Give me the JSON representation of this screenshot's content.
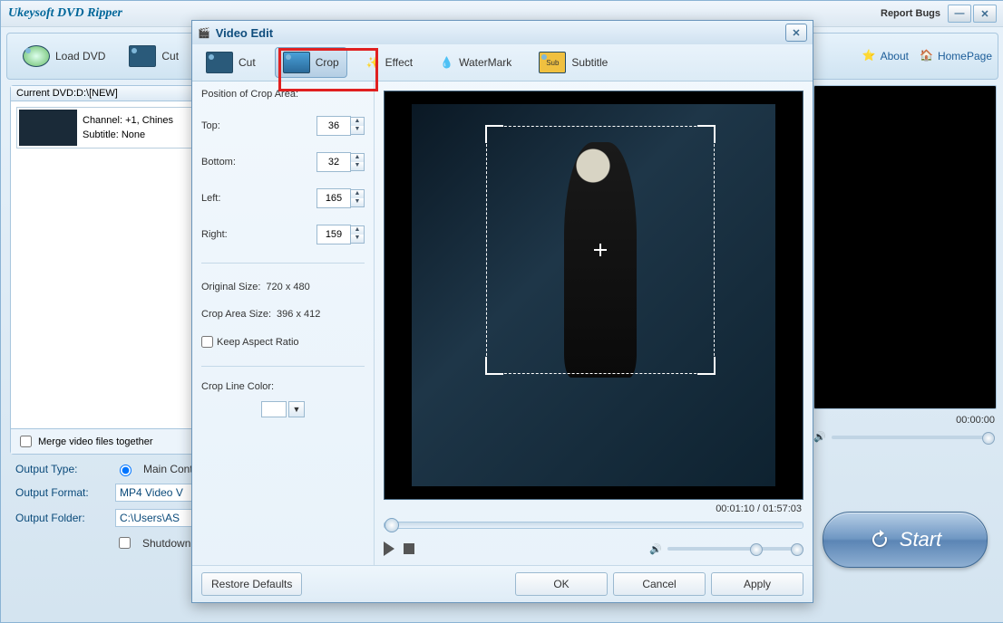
{
  "app_title": "Ukeysoft DVD Ripper",
  "report_bugs": "Report Bugs",
  "toolbar": {
    "load_dvd": "Load DVD",
    "cut": "Cut"
  },
  "links": {
    "about": "About",
    "homepage": "HomePage"
  },
  "list_header": "Current DVD:D:\\[NEW]",
  "item": {
    "channel_label": "Channel:",
    "channel_value": "+1, Chines",
    "subtitle_label": "Subtitle:",
    "subtitle_value": "None"
  },
  "merge": "Merge video files together",
  "preview_time": "00:00:00",
  "form": {
    "output_type": "Output Type:",
    "main_content": "Main Conte",
    "output_format": "Output Format:",
    "format_value": "MP4 Video V",
    "output_folder": "Output Folder:",
    "folder_value": "C:\\Users\\AS",
    "shutdown": "Shutdown"
  },
  "start": "Start",
  "dialog": {
    "title": "Video Edit",
    "tabs": {
      "cut": "Cut",
      "crop": "Crop",
      "effect": "Effect",
      "watermark": "WaterMark",
      "subtitle": "Subtitle"
    },
    "crop": {
      "heading": "Position of Crop Area:",
      "top": "Top:",
      "top_v": "36",
      "bottom": "Bottom:",
      "bottom_v": "32",
      "left": "Left:",
      "left_v": "165",
      "right": "Right:",
      "right_v": "159",
      "orig_label": "Original Size:",
      "orig_v": "720 x 480",
      "area_label": "Crop Area Size:",
      "area_v": "396 x 412",
      "keep_ar": "Keep Aspect Ratio",
      "color_label": "Crop Line Color:"
    },
    "time": "00:01:10 / 01:57:03",
    "footer": {
      "restore": "Restore Defaults",
      "ok": "OK",
      "cancel": "Cancel",
      "apply": "Apply"
    }
  }
}
